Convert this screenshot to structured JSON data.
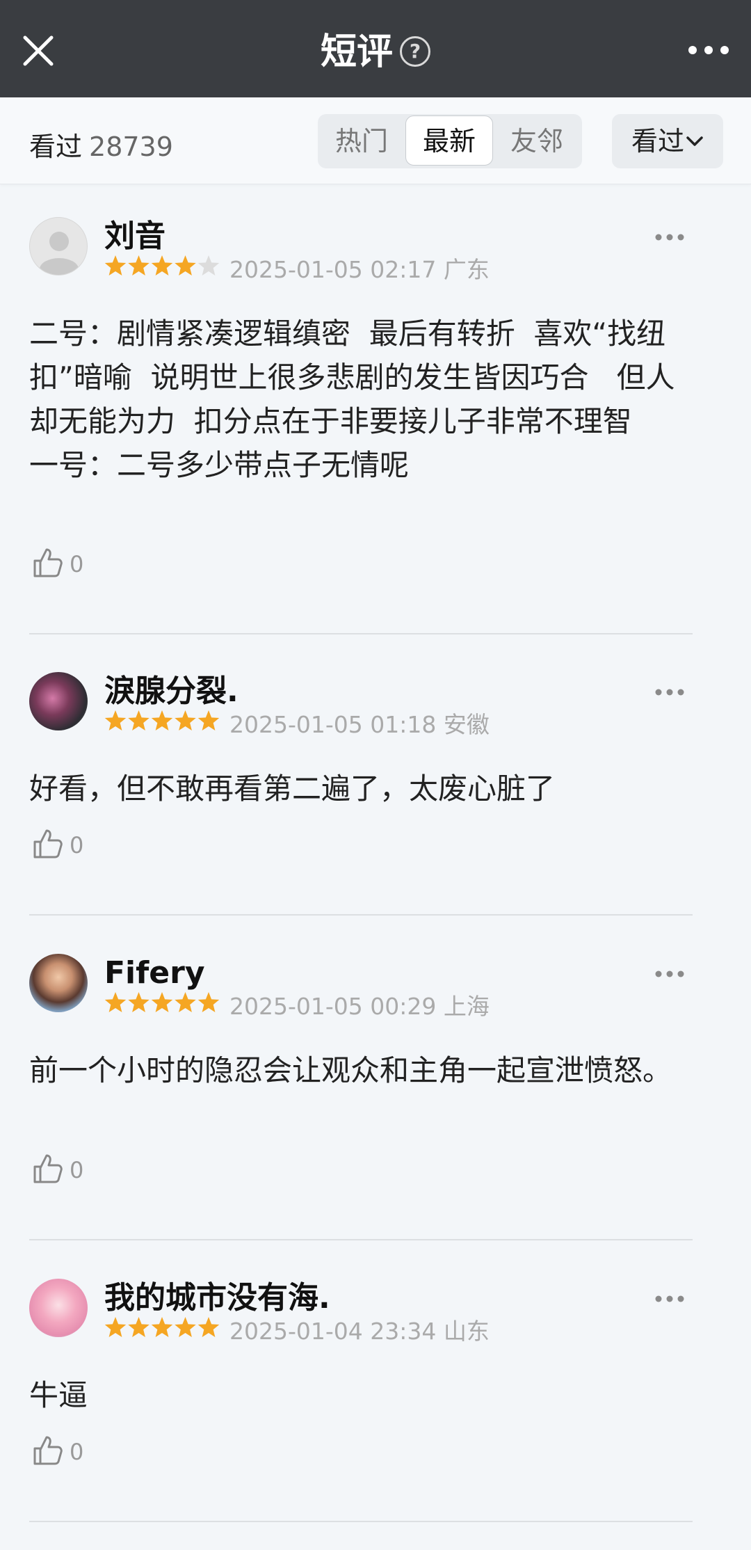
{
  "header": {
    "title": "短评",
    "help_icon": "?",
    "close_icon": "close-icon",
    "more_icon": "more-horizontal-icon"
  },
  "filter": {
    "count_label": "看过",
    "count_value": "28739",
    "tabs": [
      {
        "label": "热门",
        "active": false
      },
      {
        "label": "最新",
        "active": true
      },
      {
        "label": "友邻",
        "active": false
      }
    ],
    "dropdown_label": "看过"
  },
  "colors": {
    "star": "#f5a623",
    "header_bg": "#3a3d41"
  },
  "comments": [
    {
      "user": "刘音",
      "rating": 4,
      "date": "2025-01-05 02:17",
      "location": "广东",
      "text": "二号：剧情紧凑逻辑缜密  最后有转折  喜欢“找纽扣”暗喻  说明世上很多悲剧的发生皆因巧合   但人却无能为力  扣分点在于非要接儿子非常不理智\n一号：二号多少带点子无情呢",
      "likes": "0"
    },
    {
      "user": "淚腺分裂.",
      "rating": 5,
      "date": "2025-01-05 01:18",
      "location": "安徽",
      "text": "好看，但不敢再看第二遍了，太废心脏了",
      "likes": "0"
    },
    {
      "user": "Fifery",
      "rating": 5,
      "date": "2025-01-05 00:29",
      "location": "上海",
      "text": "前一个小时的隐忍会让观众和主角一起宣泄愤怒。",
      "likes": "0"
    },
    {
      "user": "我的城市没有海.",
      "rating": 5,
      "date": "2025-01-04 23:34",
      "location": "山东",
      "text": "牛逼",
      "likes": "0"
    }
  ]
}
